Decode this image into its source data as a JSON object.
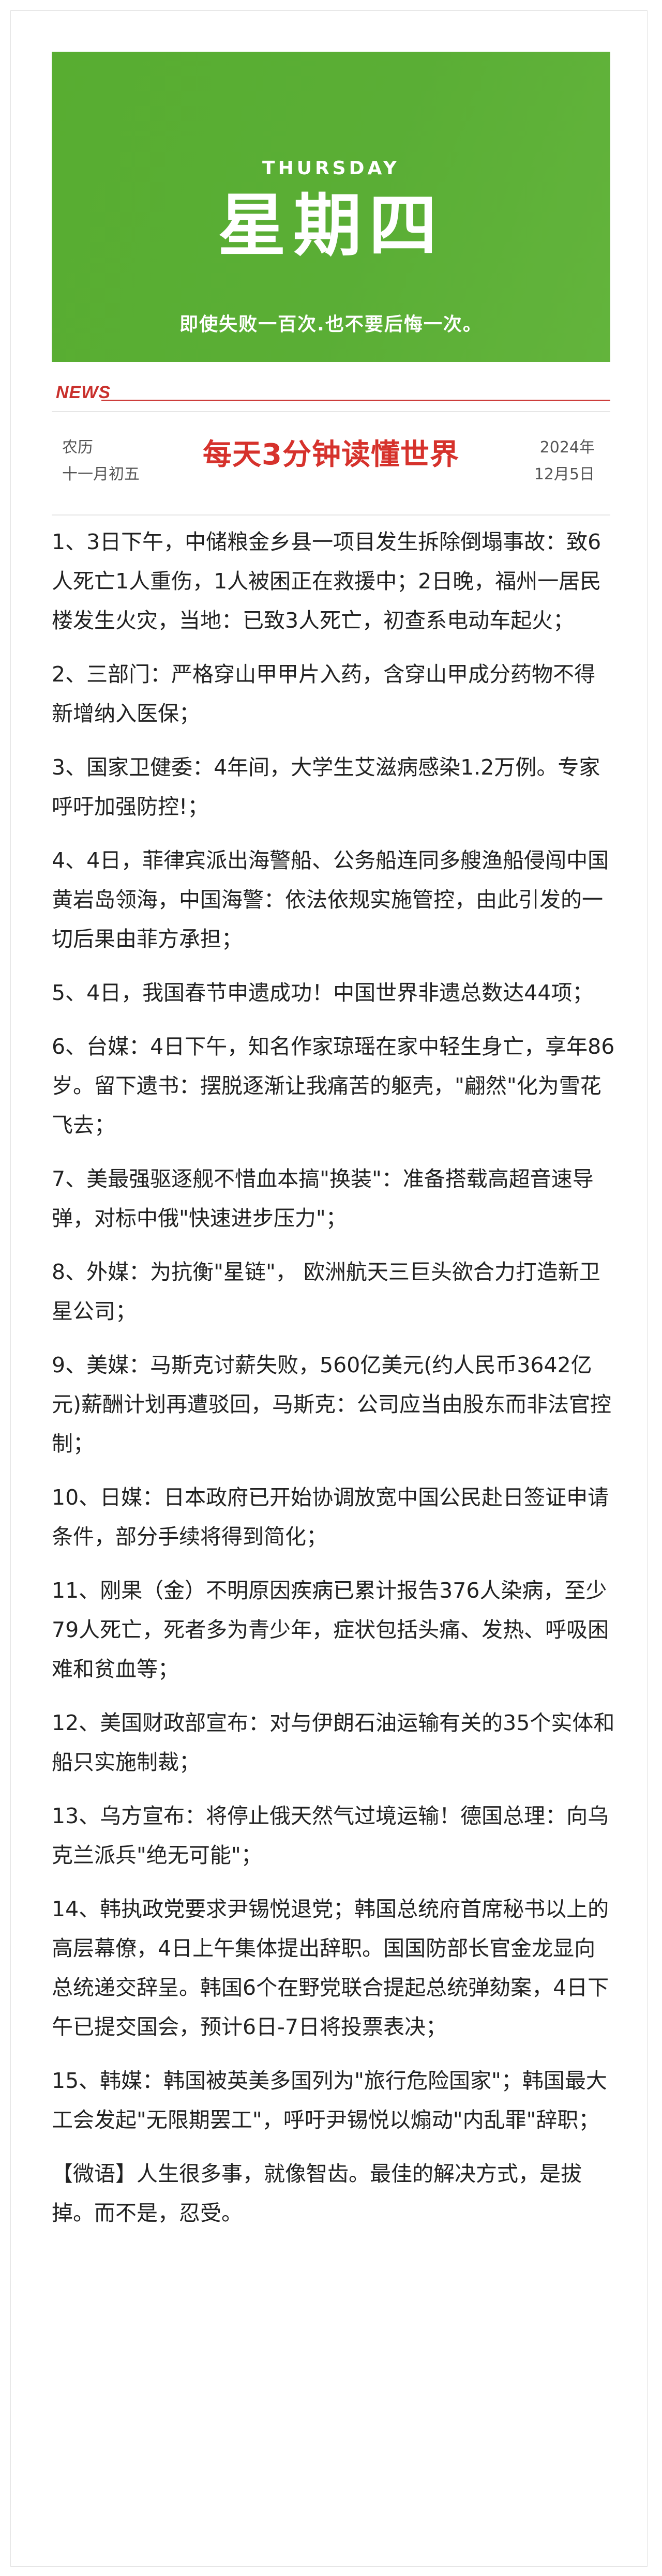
{
  "banner": {
    "day_en": "THURSDAY",
    "day_cn": "星期四",
    "motto": "即使失败一百次.也不要后悔一次。",
    "color": "#5aae35"
  },
  "news_tag": "NEWS",
  "date": {
    "lunar_label": "农历",
    "lunar_date": "十一月初五",
    "headline": "每天3分钟读懂世界",
    "year": "2024年",
    "month_day": "12月5日"
  },
  "items": [
    "1、3日下午，中储粮金乡县一项目发生拆除倒塌事故：致6人死亡1人重伤，1人被困正在救援中；2日晚，福州一居民楼发生火灾，当地：已致3人死亡，初查系电动车起火；",
    "2、三部门：严格穿山甲甲片入药，含穿山甲成分药物不得新增纳入医保；",
    "3、国家卫健委：4年间，大学生艾滋病感染1.2万例。专家呼吁加强防控!；",
    "4、4日，菲律宾派出海警船、公务船连同多艘渔船侵闯中国黄岩岛领海，中国海警：依法依规实施管控，由此引发的一切后果由菲方承担；",
    "5、4日，我国春节申遗成功！中国世界非遗总数达44项；",
    "6、台媒：4日下午，知名作家琼瑶在家中轻生身亡，享年86岁。留下遗书：摆脱逐渐让我痛苦的躯壳，\"翩然\"化为雪花飞去；",
    "7、美最强驱逐舰不惜血本搞\"换装\"：准备搭载高超音速导弹，对标中俄\"快速进步压力\"；",
    "8、外媒：为抗衡\"星链\"， 欧洲航天三巨头欲合力打造新卫星公司；",
    "9、美媒：马斯克讨薪失败，560亿美元(约人民币3642亿元)薪酬计划再遭驳回，马斯克：公司应当由股东而非法官控制；",
    "10、日媒：日本政府已开始协调放宽中国公民赴日签证申请条件，部分手续将得到简化；",
    "11、刚果（金）不明原因疾病已累计报告376人染病，至少79人死亡，死者多为青少年，症状包括头痛、发热、呼吸困难和贫血等；",
    "12、美国财政部宣布：对与伊朗石油运输有关的35个实体和船只实施制裁；",
    "13、乌方宣布：将停止俄天然气过境运输！德国总理：向乌克兰派兵\"绝无可能\"；",
    "14、韩执政党要求尹锡悦退党；韩国总统府首席秘书以上的高层幕僚，4日上午集体提出辞职。国国防部长官金龙显向总统递交辞呈。韩国6个在野党联合提起总统弹劾案，4日下午已提交国会，预计6日-7日将投票表决；",
    "15、韩媒：韩国被英美多国列为\"旅行危险国家\"；韩国最大工会发起\"无限期罢工\"，呼吁尹锡悦以煽动\"内乱罪\"辞职；",
    "【微语】人生很多事，就像智齿。最佳的解决方式，是拔掉。而不是，忍受。"
  ]
}
